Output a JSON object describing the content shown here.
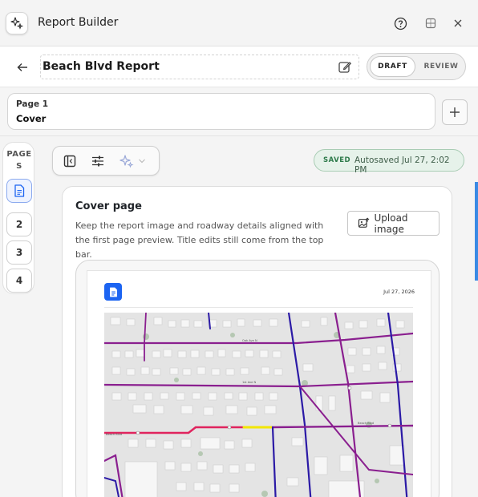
{
  "app": {
    "title": "Report Builder"
  },
  "report": {
    "title": "Beach Blvd Report"
  },
  "mode_toggle": {
    "draft_label": "DRAFT",
    "review_label": "REVIEW",
    "selected": "DRAFT"
  },
  "current_page": {
    "number_label": "Page 1",
    "name": "Cover"
  },
  "pages_rail": {
    "label": "PAGES",
    "pages": [
      "2",
      "3",
      "4"
    ]
  },
  "status": {
    "badge": "SAVED",
    "text": "Autosaved Jul 27, 2:02 PM"
  },
  "cover": {
    "title": "Cover page",
    "description": "Keep the report image and roadway details aligned with the first page preview. Title edits still come from the top bar.",
    "upload_label": "Upload image"
  },
  "preview": {
    "date": "Jul 27, 2026",
    "map_labels": [
      "Oak Ave N",
      "1st Ave N",
      "Beach Blvd",
      "Beach Blvd"
    ]
  },
  "colors": {
    "accent": "#1c64f2",
    "saved_green": "#2d7a4a",
    "road_purple": "#8a1f8f",
    "road_navy": "#2b1aa6",
    "road_red": "#e0245e",
    "road_yellow": "#f2e600"
  },
  "icons": [
    "spark-icon",
    "help-icon",
    "minimize-icon",
    "close-icon",
    "back-arrow-icon",
    "edit-icon",
    "plus-icon",
    "document-icon",
    "sidebar-toggle-icon",
    "sliders-icon",
    "ai-spark-icon",
    "chevron-down-icon",
    "image-upload-icon"
  ]
}
